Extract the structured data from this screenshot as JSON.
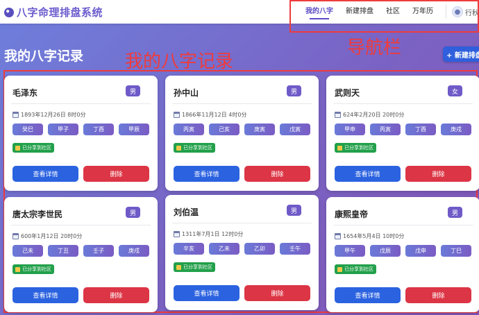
{
  "app": {
    "title": "八字命理排盘系统"
  },
  "nav": {
    "items": [
      {
        "label": "我的八字",
        "active": true
      },
      {
        "label": "新建排盘",
        "active": false
      },
      {
        "label": "社区",
        "active": false
      },
      {
        "label": "万年历",
        "active": false
      }
    ],
    "user_name": "行秋"
  },
  "annotations": {
    "nav_label": "导航栏",
    "records_label": "我的八字记录",
    "color": "#ef3b3b"
  },
  "page": {
    "title": "我的八字记录",
    "new_button": "+ 新建排盘"
  },
  "card_labels": {
    "shared": "已分享到社区",
    "view": "查看详情",
    "delete": "删除"
  },
  "records": [
    {
      "name": "毛泽东",
      "gender": "男",
      "birth": "1893年12月26日 8时0分",
      "pillars": [
        "癸巳",
        "甲子",
        "丁酉",
        "甲辰"
      ]
    },
    {
      "name": "孙中山",
      "gender": "男",
      "birth": "1866年11月12日 4时0分",
      "pillars": [
        "丙寅",
        "己亥",
        "庚寅",
        "戊寅"
      ]
    },
    {
      "name": "武则天",
      "gender": "女",
      "birth": "624年2月20日 20时0分",
      "pillars": [
        "甲申",
        "丙寅",
        "丁酉",
        "庚戌"
      ]
    },
    {
      "name": "唐太宗李世民",
      "gender": "男",
      "birth": "600年1月12日 20时0分",
      "pillars": [
        "己未",
        "丁丑",
        "壬子",
        "庚戌"
      ]
    },
    {
      "name": "刘伯温",
      "gender": "男",
      "birth": "1311年7月1日 12时0分",
      "pillars": [
        "辛亥",
        "乙未",
        "乙卯",
        "壬午"
      ]
    },
    {
      "name": "康熙皇帝",
      "gender": "男",
      "birth": "1654年5月4日 10时0分",
      "pillars": [
        "甲午",
        "戊辰",
        "戊申",
        "丁巳"
      ]
    }
  ],
  "colors": {
    "brand": "#6a5acd",
    "view_button": "#2b62e0",
    "delete_button": "#dc3545",
    "shared_badge": "#22a04a",
    "gender_badge": "#6f5ac8"
  }
}
